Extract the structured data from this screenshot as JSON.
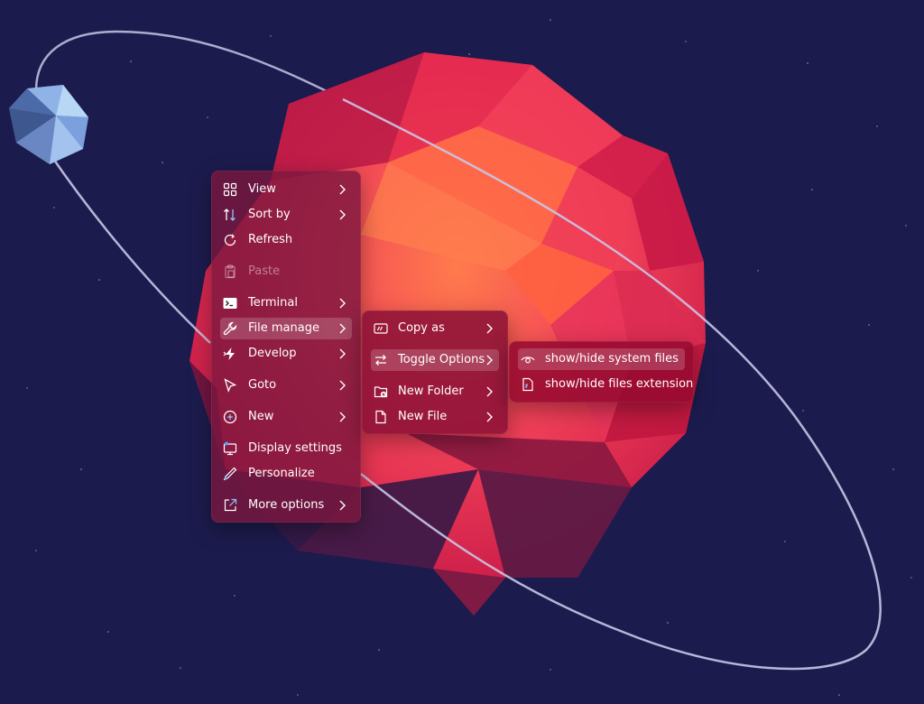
{
  "context_menu": {
    "items": [
      {
        "label": "View",
        "icon": "grid-icon",
        "has_submenu": true
      },
      {
        "label": "Sort by",
        "icon": "sort-icon",
        "has_submenu": true
      },
      {
        "label": "Refresh",
        "icon": "refresh-icon",
        "has_submenu": false
      },
      {
        "label": "Paste",
        "icon": "paste-icon",
        "has_submenu": false,
        "disabled": true
      },
      {
        "label": "Terminal",
        "icon": "terminal-icon",
        "has_submenu": true
      },
      {
        "label": "File manage",
        "icon": "wrench-icon",
        "has_submenu": true,
        "active": true
      },
      {
        "label": "Develop",
        "icon": "lightning-icon",
        "has_submenu": true
      },
      {
        "label": "Goto",
        "icon": "cursor-icon",
        "has_submenu": true
      },
      {
        "label": "New",
        "icon": "plus-circle-icon",
        "has_submenu": true
      },
      {
        "label": "Display settings",
        "icon": "display-icon",
        "has_submenu": false
      },
      {
        "label": "Personalize",
        "icon": "pen-icon",
        "has_submenu": false
      },
      {
        "label": "More options",
        "icon": "external-icon",
        "has_submenu": true
      }
    ]
  },
  "file_manage_menu": {
    "items": [
      {
        "label": "Copy as",
        "icon": "copy-as-icon",
        "has_submenu": true
      },
      {
        "label": "Toggle Options",
        "icon": "swap-icon",
        "has_submenu": true,
        "active": true
      },
      {
        "label": "New Folder",
        "icon": "folder-add-icon",
        "has_submenu": true
      },
      {
        "label": "New File",
        "icon": "file-icon",
        "has_submenu": true
      }
    ]
  },
  "toggle_options_menu": {
    "items": [
      {
        "label": "show/hide system files",
        "icon": "eye-icon",
        "active": true
      },
      {
        "label": "show/hide files extension",
        "icon": "file-extension-icon"
      }
    ]
  },
  "colors": {
    "background": "#1c1b4d",
    "planet_red": "#d81b4a",
    "planet_orange": "#ff6a45",
    "moon_blue": "#8fb3e6",
    "orbit": "#c9c6e8"
  }
}
